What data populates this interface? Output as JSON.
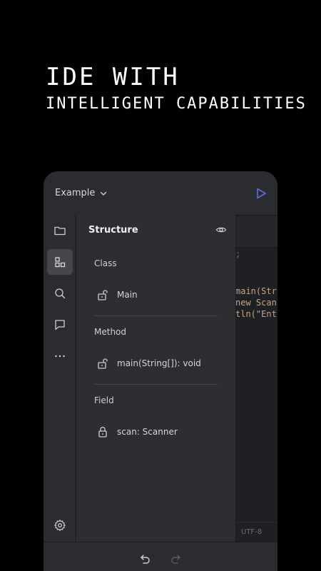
{
  "headline": {
    "line1": "IDE WITH",
    "line2": "INTELLIGENT CAPABILITIES"
  },
  "topbar": {
    "project_name": "Example"
  },
  "structure_panel": {
    "title": "Structure",
    "sections": [
      {
        "label": "Class",
        "items": [
          {
            "label": "Main",
            "icon": "unlock-icon"
          }
        ]
      },
      {
        "label": "Method",
        "items": [
          {
            "label": "main(String[]): void",
            "icon": "unlock-icon"
          }
        ]
      },
      {
        "label": "Field",
        "items": [
          {
            "label": "scan: Scanner",
            "icon": "lock-icon"
          }
        ]
      }
    ]
  },
  "editor": {
    "lines": [
      ";",
      "main(Str",
      "new Scan",
      "tln(\"Ent"
    ],
    "status": "UTF-8"
  },
  "colors": {
    "accent": "#5b6ee1",
    "background": "#000000",
    "panel": "#2d2e31"
  }
}
